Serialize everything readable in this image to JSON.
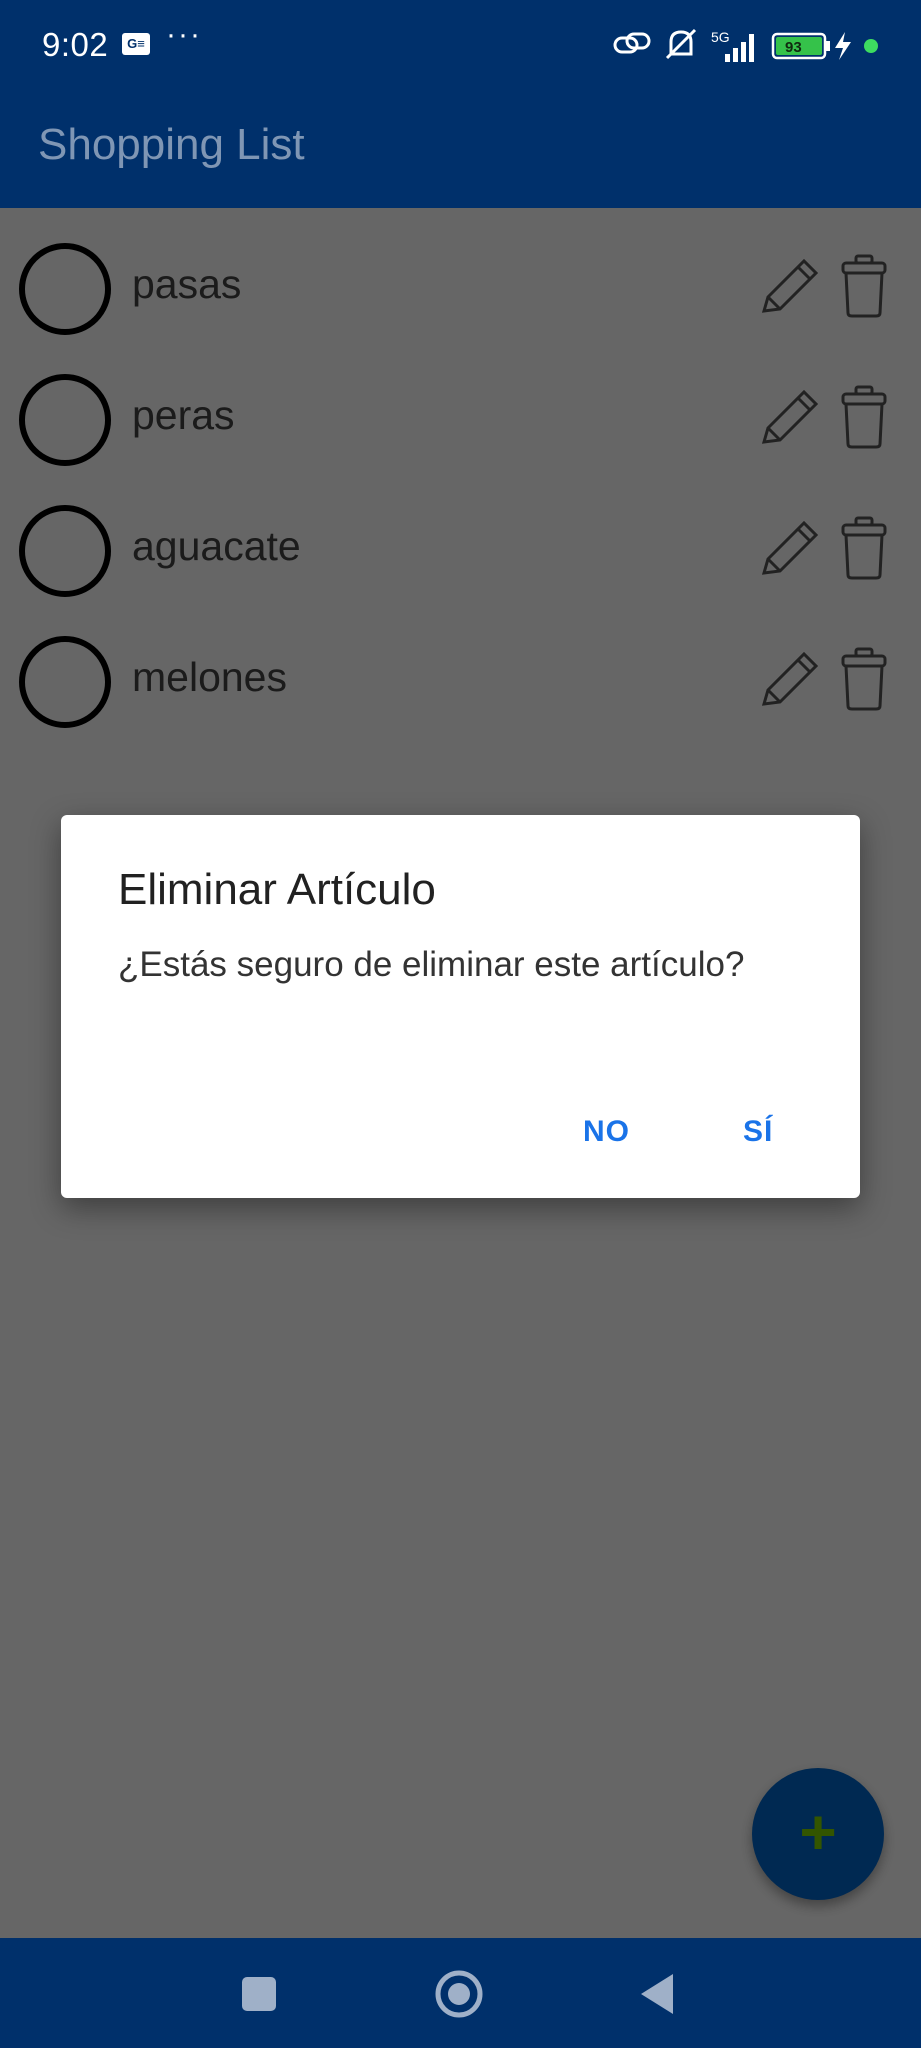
{
  "status_bar": {
    "time": "9:02",
    "app_icon_text": "G≡",
    "more": "···",
    "network": "5G",
    "battery": "93"
  },
  "app_bar": {
    "title": "Shopping List"
  },
  "items": [
    {
      "name": "pasas"
    },
    {
      "name": "peras"
    },
    {
      "name": "aguacate"
    },
    {
      "name": "melones"
    }
  ],
  "fab": {
    "label": "+"
  },
  "dialog": {
    "title": "Eliminar Artículo",
    "message": "¿Estás seguro de eliminar este artículo?",
    "no_label": "NO",
    "yes_label": "SÍ"
  },
  "colors": {
    "primary": "#00306b",
    "accent": "#1a73e8",
    "fab": "#0066cc"
  }
}
